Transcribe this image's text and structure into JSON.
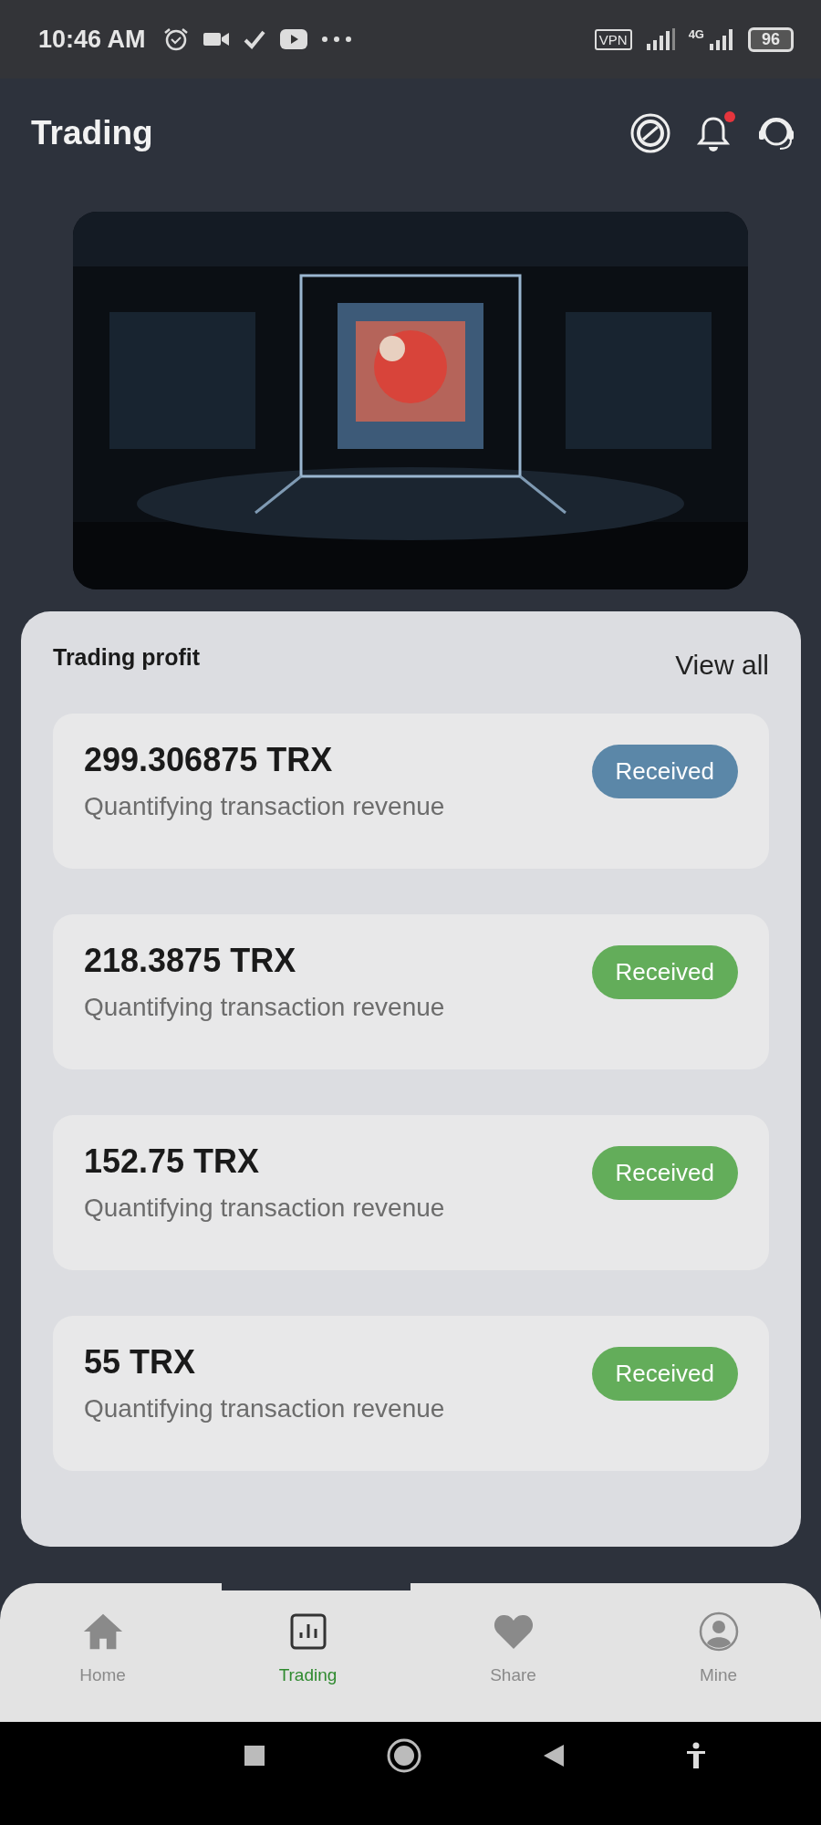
{
  "status_bar": {
    "time": "10:46 AM",
    "vpn": "VPN",
    "network": "4G",
    "battery": "96"
  },
  "header": {
    "title": "Trading",
    "notification_dot": true
  },
  "profit_card": {
    "title": "Trading profit",
    "view_all": "View all",
    "items": [
      {
        "amount": "299.306875 TRX",
        "description": "Quantifying transaction revenue",
        "status": "Received",
        "color": "#5b87a8"
      },
      {
        "amount": "218.3875 TRX",
        "description": "Quantifying transaction revenue",
        "status": "Received",
        "color": "#63ad5a"
      },
      {
        "amount": "152.75 TRX",
        "description": "Quantifying transaction revenue",
        "status": "Received",
        "color": "#63ad5a"
      },
      {
        "amount": "55 TRX",
        "description": "Quantifying transaction revenue",
        "status": "Received",
        "color": "#63ad5a"
      }
    ]
  },
  "tab_bar": [
    {
      "label": "Home",
      "kind": "home",
      "selected": false
    },
    {
      "label": "Trading",
      "kind": "chart",
      "selected": true
    },
    {
      "label": "Share",
      "kind": "heart",
      "selected": false
    },
    {
      "label": "Mine",
      "kind": "user",
      "selected": false
    }
  ]
}
